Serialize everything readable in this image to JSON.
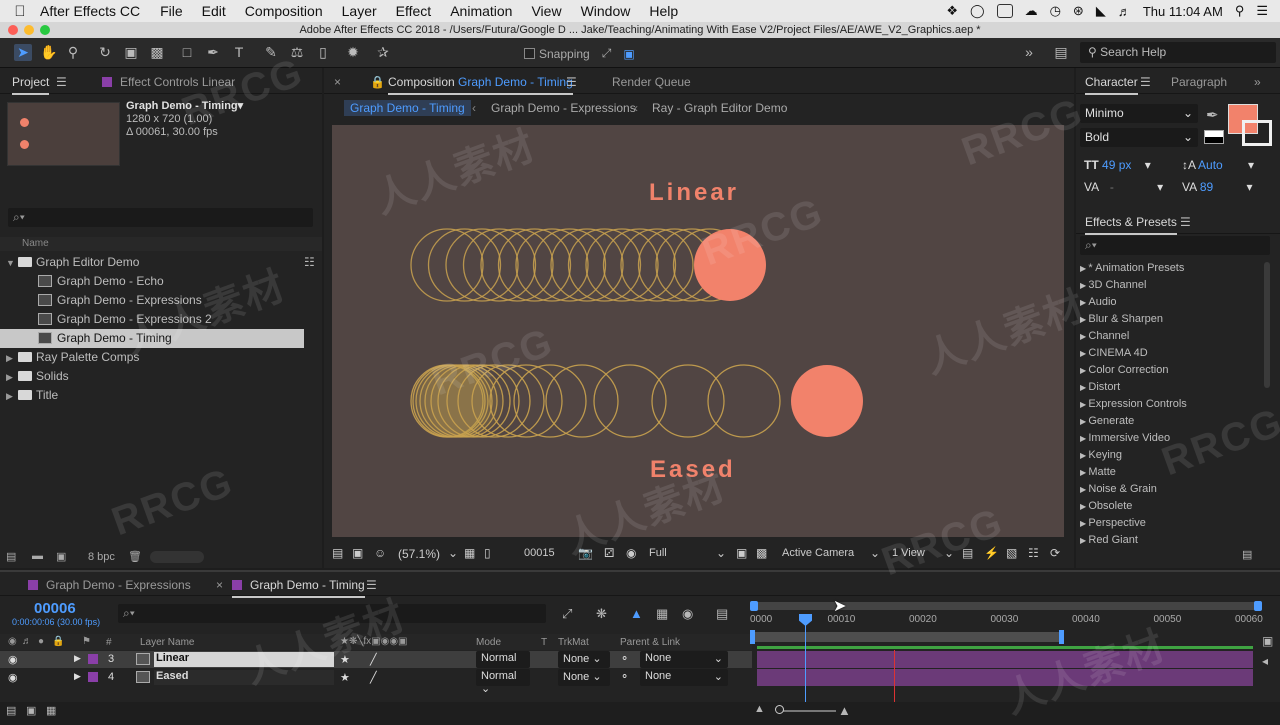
{
  "menubar": {
    "app": "After Effects CC",
    "items": [
      "File",
      "Edit",
      "Composition",
      "Layer",
      "Effect",
      "Animation",
      "View",
      "Window",
      "Help"
    ],
    "clock": "Thu 11:04 AM"
  },
  "titlebar": {
    "title": "Adobe After Effects CC 2018 - /Users/Futura/Google D ... Jake/Teaching/Animating With Ease V2/Project Files/AE/AWE_V2_Graphics.aep *"
  },
  "toolbar": {
    "snapping": "Snapping",
    "search_help": "Search Help"
  },
  "project": {
    "tab_project": "Project",
    "tab_effect_controls": "Effect Controls Linear",
    "comp_name": "Graph Demo - Timing▾",
    "comp_size": "1280 x 720 (1.00)",
    "comp_duration": "Δ 00061, 30.00 fps",
    "search_placeholder": "⌕▾",
    "col_name": "Name",
    "items": [
      {
        "label": "Graph Editor Demo"
      },
      {
        "label": "Graph Demo - Echo"
      },
      {
        "label": "Graph Demo - Expressions"
      },
      {
        "label": "Graph Demo - Expressions 2"
      },
      {
        "label": "Graph Demo - Timing"
      },
      {
        "label": "Ray Palette Comps"
      },
      {
        "label": "Solids"
      },
      {
        "label": "Title"
      }
    ],
    "bpc": "8 bpc"
  },
  "comp": {
    "tab_prefix": "Composition",
    "tab_name": "Graph Demo - Timing",
    "render_queue": "Render Queue",
    "crumbs": [
      "Graph Demo - Timing",
      "Graph Demo - Expressions",
      "Ray - Graph Editor Demo"
    ],
    "label_linear": "Linear",
    "label_eased": "Eased",
    "zoom": "(57.1%)",
    "frame": "00015",
    "resolution": "Full",
    "camera": "Active Camera",
    "views": "1 View"
  },
  "character": {
    "tab_character": "Character",
    "tab_paragraph": "Paragraph",
    "font": "Minimo",
    "style": "Bold",
    "size": "49 px",
    "leading": "Auto",
    "kerning": "-",
    "tracking": "89",
    "fill_color": "#f2826b"
  },
  "effects": {
    "title": "Effects & Presets",
    "search_placeholder": "⌕▾",
    "items": [
      "* Animation Presets",
      "3D Channel",
      "Audio",
      "Blur & Sharpen",
      "Channel",
      "CINEMA 4D",
      "Color Correction",
      "Distort",
      "Expression Controls",
      "Generate",
      "Immersive Video",
      "Keying",
      "Matte",
      "Noise & Grain",
      "Obsolete",
      "Perspective",
      "Red Giant"
    ]
  },
  "timeline": {
    "tab1": "Graph Demo - Expressions",
    "tab2": "Graph Demo - Timing",
    "timecode": "00006",
    "timecode_sub": "0:00:00:06 (30.00 fps)",
    "search_placeholder": "⌕▾",
    "col_layer_name": "Layer Name",
    "col_mode": "Mode",
    "col_t": "T",
    "col_trkmat": "TrkMat",
    "col_parent": "Parent & Link",
    "ticks": [
      "0000",
      "00010",
      "00020",
      "00030",
      "00040",
      "00050",
      "00060"
    ],
    "layers": [
      {
        "num": "3",
        "name": "Linear",
        "mode": "Normal",
        "trkmat": "None",
        "parent": "None"
      },
      {
        "num": "4",
        "name": "Eased",
        "mode": "Normal",
        "trkmat": "None",
        "parent": "None"
      }
    ]
  },
  "watermark": {
    "text1": "RRCG",
    "text2": "人人素材"
  }
}
